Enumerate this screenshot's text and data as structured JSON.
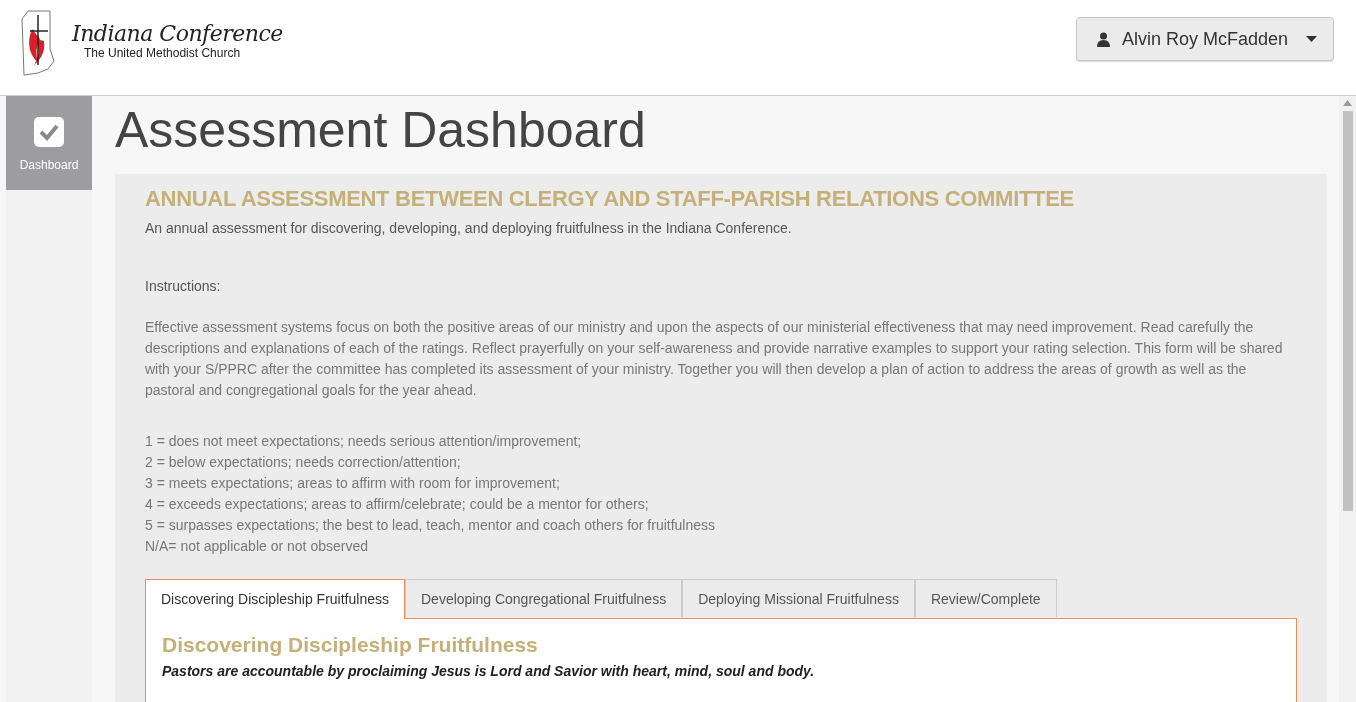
{
  "header": {
    "logo_title": "Indiana Conference",
    "logo_subtitle": "The United Methodist Church",
    "user_menu": "Alvin Roy McFadden"
  },
  "sidebar": {
    "items": [
      {
        "label": "Dashboard",
        "selected": true
      }
    ]
  },
  "page_title": "Assessment Dashboard",
  "assessment": {
    "title": "ANNUAL ASSESSMENT BETWEEN CLERGY AND STAFF-PARISH RELATIONS COMMITTEE",
    "description": "An annual assessment for discovering, developing, and deploying fruitfulness in the Indiana Conference.",
    "instructions_label": "Instructions:",
    "instructions": "Effective assessment systems focus on both the positive areas of our ministry and upon the aspects of our ministerial effectiveness that may need improvement. Read carefully the descriptions and explanations of each of the ratings. Reflect prayerfully on your self-awareness and provide narrative examples to support your rating selection. This form will be shared with your S/PPRC after the committee has completed its assessment of your ministry. Together you will then develop a plan of action to address the areas of growth as well as the pastoral and congregational goals for the year ahead.",
    "ratings": [
      "1 = does not meet expectations; needs serious attention/improvement;",
      "2 = below expectations; needs correction/attention;",
      "3 = meets expectations; areas to affirm with room for improvement;",
      "4 = exceeds expectations; areas to affirm/celebrate; could be a mentor for others;",
      "5 = surpasses expectations; the best to lead, teach, mentor and coach others for fruitfulness",
      "N/A= not applicable or not observed"
    ],
    "tabs": [
      {
        "label": "Discovering Discipleship Fruitfulness",
        "selected": true
      },
      {
        "label": "Developing Congregational Fruitfulness",
        "selected": false
      },
      {
        "label": "Deploying Missional Fruitfulness",
        "selected": false
      },
      {
        "label": "Review/Complete",
        "selected": false
      }
    ],
    "section_title": "Discovering Discipleship Fruitfulness",
    "section_statement": "Pastors are accountable by proclaiming Jesus is Lord and Savior with heart, mind, soul and body."
  }
}
